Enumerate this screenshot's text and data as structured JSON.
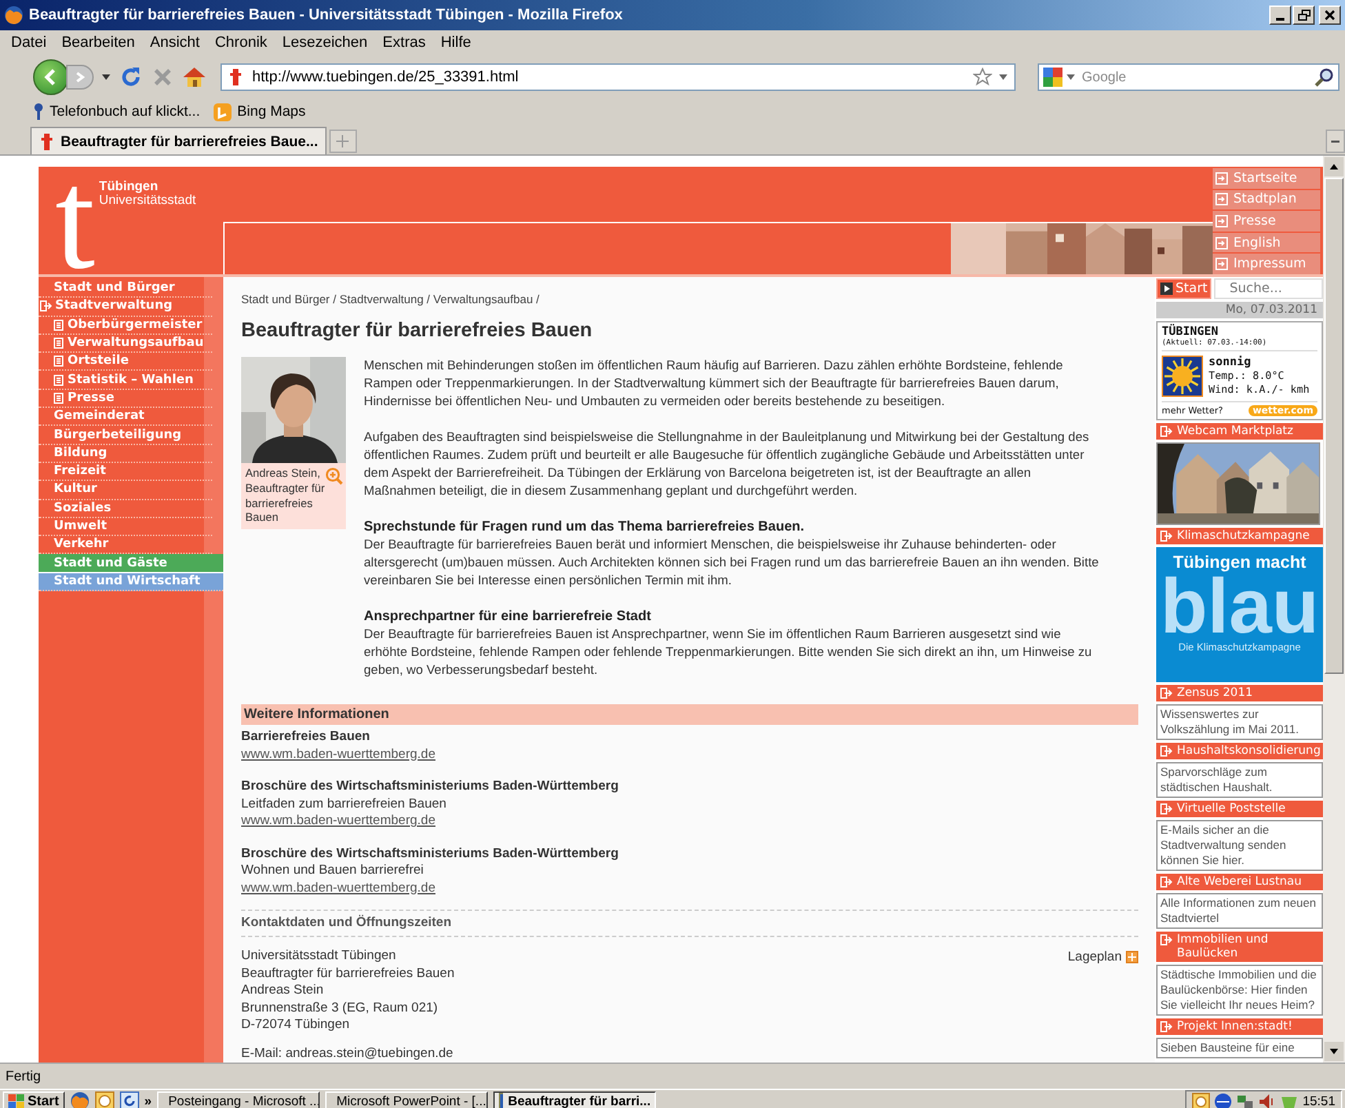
{
  "window": {
    "title": "Beauftragter für barrierefreies Bauen - Universitätsstadt Tübingen - Mozilla Firefox"
  },
  "menu": [
    "Datei",
    "Bearbeiten",
    "Ansicht",
    "Chronik",
    "Lesezeichen",
    "Extras",
    "Hilfe"
  ],
  "toolbar": {
    "url": "http://www.tuebingen.de/25_33391.html",
    "search_placeholder": "Google"
  },
  "bookmarks": [
    "Telefonbuch auf klickt...",
    "Bing Maps"
  ],
  "tabs": [
    {
      "label": "Beauftragter für barrierefreies Baue...",
      "selected": true
    }
  ],
  "site": {
    "logo": {
      "mark": "t",
      "line1": "Tübingen",
      "line2": "Universitätsstadt"
    },
    "top_links": [
      "Startseite",
      "Stadtplan",
      "Presse",
      "English",
      "Impressum"
    ],
    "nav": [
      {
        "label": "Stadt und Bürger",
        "kind": "item"
      },
      {
        "label": "Stadtverwaltung",
        "kind": "current"
      },
      {
        "label": "Oberbürgermeister",
        "kind": "sub"
      },
      {
        "label": "Verwaltungsaufbau",
        "kind": "sub"
      },
      {
        "label": "Ortsteile",
        "kind": "sub"
      },
      {
        "label": "Statistik – Wahlen",
        "kind": "sub"
      },
      {
        "label": "Presse",
        "kind": "sub"
      },
      {
        "label": "Gemeinderat",
        "kind": "item"
      },
      {
        "label": "Bürgerbeteiligung",
        "kind": "item"
      },
      {
        "label": "Bildung",
        "kind": "item"
      },
      {
        "label": "Freizeit",
        "kind": "item"
      },
      {
        "label": "Kultur",
        "kind": "item"
      },
      {
        "label": "Soziales",
        "kind": "item"
      },
      {
        "label": "Umwelt",
        "kind": "item"
      },
      {
        "label": "Verkehr",
        "kind": "item"
      },
      {
        "label": "Stadt und Gäste",
        "kind": "guests"
      },
      {
        "label": "Stadt und Wirtschaft",
        "kind": "business"
      }
    ],
    "breadcrumb": "Stadt und Bürger / Stadtverwaltung / Verwaltungsaufbau /",
    "heading": "Beauftragter für barrierefreies Bauen",
    "photo_caption": "Andreas Stein, Beauftragter für barrierefreies Bauen",
    "sections": [
      {
        "text": "Menschen mit Behinderungen stoßen im öffentlichen Raum häufig auf Barrieren. Dazu zählen erhöhte Bordsteine, fehlende Rampen oder Treppenmarkierungen. In der Stadtverwaltung kümmert sich der Beauftragte für barrierefreies Bauen darum, Hindernisse bei öffentlichen Neu- und Umbauten zu vermeiden oder bereits bestehende zu beseitigen."
      },
      {
        "text": "Aufgaben des Beauftragten sind beispielsweise die Stellungnahme in der Bauleitplanung und Mitwirkung bei der Gestaltung des öffentlichen Raumes. Zudem prüft und beurteilt er alle Baugesuche für öffentlich zugängliche Gebäude und Arbeitsstätten unter dem Aspekt der Barrierefreiheit. Da Tübingen der Erklärung von Barcelona beigetreten ist, ist der Beauftragte an allen Maßnahmen beteiligt, die in diesem Zusammenhang geplant und durchgeführt werden."
      },
      {
        "heading": "Sprechstunde für Fragen rund um das Thema barrierefreies Bauen.",
        "text": "Der Beauftragte für barrierefreies Bauen berät und informiert Menschen, die beispielsweise ihr Zuhause behinderten- oder altersgerecht (um)bauen müssen. Auch Architekten können sich bei Fragen rund um das barrierefreie Bauen an ihn wenden. Bitte vereinbaren Sie bei Interesse einen persönlichen Termin mit ihm."
      },
      {
        "heading": "Ansprechpartner für eine barrierefreie Stadt",
        "text": "Der Beauftragte für barrierefreies Bauen ist Ansprechpartner, wenn Sie im öffentlichen Raum Barrieren ausgesetzt sind wie erhöhte Bordsteine, fehlende Rampen oder fehlende Treppenmarkierungen. Bitte wenden Sie sich direkt an ihn, um Hinweise zu geben, wo Verbesserungsbedarf besteht."
      }
    ],
    "more_info": {
      "title": "Weitere Informationen",
      "items": [
        {
          "title": "Barrierefreies Bauen",
          "link": "www.wm.baden-wuerttemberg.de"
        },
        {
          "title": "Broschüre des Wirtschaftsministeriums Baden-Württemberg",
          "subtitle": "Leitfaden zum barrierefreien Bauen",
          "link": "www.wm.baden-wuerttemberg.de"
        },
        {
          "title": "Broschüre des Wirtschaftsministeriums Baden-Württemberg",
          "subtitle": "Wohnen und Bauen barrierefrei",
          "link": "www.wm.baden-wuerttemberg.de"
        }
      ]
    },
    "contact": {
      "title": "Kontaktdaten und Öffnungszeiten",
      "lines": [
        "Universitätsstadt Tübingen",
        "Beauftragter für barrierefreies Bauen",
        "Andreas Stein",
        "Brunnenstraße 3 (EG, Raum 021)",
        "D-72074 Tübingen"
      ],
      "map_link": "Lageplan",
      "email": "E-Mail: andreas.stein@tuebingen.de"
    },
    "right": {
      "search_button": "Start",
      "search_placeholder": "Suche...",
      "date": "Mo, 07.03.2011",
      "weather": {
        "city": "TÜBINGEN",
        "updated": "(Aktuell: 07.03.-14:00)",
        "condition": "sonnig",
        "temp": "Temp.: 8.0°C",
        "wind": "Wind: k.A./- kmh",
        "more": "mehr Wetter?",
        "badge": "wetter.com"
      },
      "boxes": [
        {
          "title": "Webcam Marktplatz",
          "kind": "picture"
        },
        {
          "title": "Klimaschutzkampagne",
          "kind": "banner",
          "line1": "Tübingen macht",
          "line2": "blau",
          "line3": "Die Klimaschutzkampagne"
        },
        {
          "title": "Zensus 2011",
          "kind": "text",
          "text": "Wissenswertes zur Volkszählung im Mai 2011."
        },
        {
          "title": "Haushaltskonsolidierung",
          "kind": "text",
          "text": "Sparvorschläge zum städtischen Haushalt."
        },
        {
          "title": "Virtuelle Poststelle",
          "kind": "text",
          "text": "E-Mails sicher an die Stadtverwaltung senden können Sie hier."
        },
        {
          "title": "Alte Weberei Lustnau",
          "kind": "text",
          "text": "Alle Informationen zum neuen Stadtviertel"
        },
        {
          "title": "Immobilien und Baulücken",
          "kind": "text",
          "text": "Städtische Immobilien und die Baulückenbörse: Hier finden Sie vielleicht Ihr neues Heim?"
        },
        {
          "title": "Projekt Innen:stadt!",
          "kind": "text",
          "text": "Sieben Bausteine für eine"
        }
      ]
    }
  },
  "status": "Fertig",
  "taskbar": {
    "start": "Start",
    "chevron": "»",
    "tasks": [
      {
        "label": "Posteingang - Microsoft ...",
        "selected": false
      },
      {
        "label": "Microsoft PowerPoint - [...",
        "selected": false
      },
      {
        "label": "Beauftragter für barri...",
        "selected": true
      }
    ],
    "time": "15:51"
  }
}
